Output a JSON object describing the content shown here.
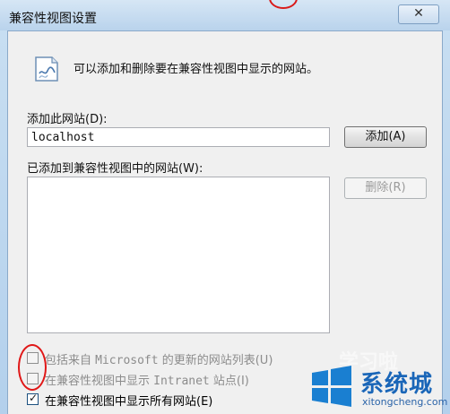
{
  "window": {
    "title": "兼容性视图设置",
    "close_icon": "close-icon",
    "close_glyph": "✕"
  },
  "info": {
    "icon": "webpage-icon",
    "text": "可以添加和删除要在兼容性视图中显示的网站。"
  },
  "add_site": {
    "label": "添加此网站(D):",
    "value": "localhost",
    "add_button": "添加(A)"
  },
  "added_sites": {
    "label": "已添加到兼容性视图中的网站(W):",
    "items": [],
    "remove_button": "删除(R)"
  },
  "options": [
    {
      "label_pre": "包括来自 ",
      "label_mono": "Microsoft",
      "label_post": " 的更新的网站列表(U)",
      "checked": false,
      "enabled": false
    },
    {
      "label_pre": "在兼容性视图中显示 ",
      "label_mono": "Intranet",
      "label_post": " 站点(I)",
      "checked": false,
      "enabled": false
    },
    {
      "label_pre": "在兼容性视图中显示所有网站(E)",
      "label_mono": "",
      "label_post": "",
      "checked": true,
      "enabled": true
    }
  ],
  "watermark": {
    "brand": "系统城",
    "url": "xitongcheng.com",
    "faint": "学习啦"
  },
  "colors": {
    "annotation_red": "#e01818",
    "title_bar": "#c9dff2",
    "watermark_blue": "#1a66b8"
  }
}
